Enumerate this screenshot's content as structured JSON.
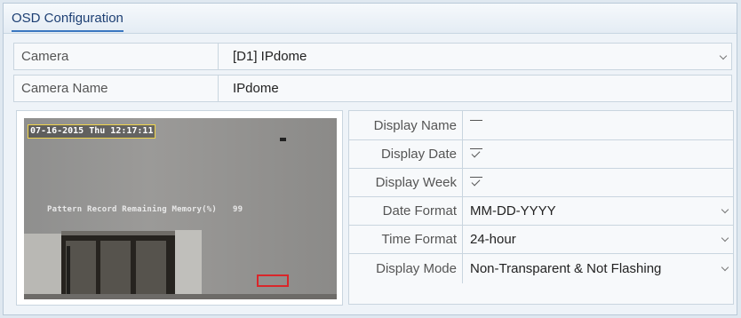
{
  "tab": {
    "title": "OSD Configuration"
  },
  "camera": {
    "label": "Camera",
    "value": "[D1] IPdome"
  },
  "camera_name": {
    "label": "Camera Name",
    "value": "IPdome"
  },
  "preview": {
    "osd_date": "07-16-2015 Thu 12:17:11",
    "osd_text": "Pattern Record Remaining Memory(%)",
    "osd_value": "99"
  },
  "settings": {
    "display_name": {
      "label": "Display Name",
      "checked": false
    },
    "display_date": {
      "label": "Display Date",
      "checked": true
    },
    "display_week": {
      "label": "Display Week",
      "checked": true
    },
    "date_format": {
      "label": "Date Format",
      "value": "MM-DD-YYYY"
    },
    "time_format": {
      "label": "Time Format",
      "value": "24-hour"
    },
    "display_mode": {
      "label": "Display Mode",
      "value": "Non-Transparent & Not Flashing"
    }
  },
  "icons": {
    "dropdown": "chevron-down-icon",
    "checkbox": "checkbox-icon"
  }
}
